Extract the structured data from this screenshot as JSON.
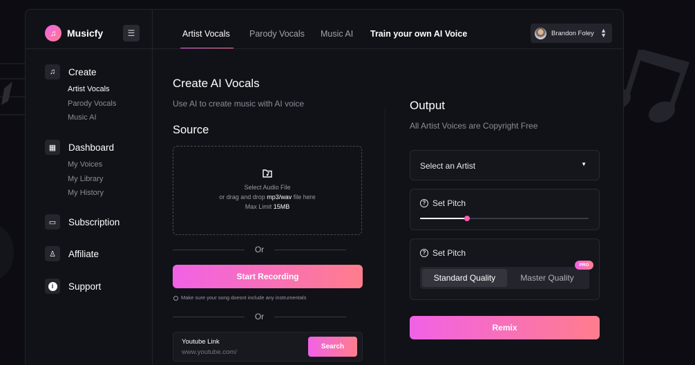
{
  "app": {
    "name": "Musicfy",
    "logo_icon": "music-note-icon"
  },
  "sidebar": {
    "groups": [
      {
        "label": "Create",
        "icon": "music-note-icon",
        "items": [
          "Artist Vocals",
          "Parody Vocals",
          "Music AI"
        ],
        "active_item": "Artist Vocals"
      },
      {
        "label": "Dashboard",
        "icon": "grid-icon",
        "items": [
          "My Voices",
          "My Library",
          "My History"
        ]
      },
      {
        "label": "Subscription",
        "icon": "ticket-icon",
        "items": []
      },
      {
        "label": "Affiliate",
        "icon": "users-icon",
        "items": []
      },
      {
        "label": "Support",
        "icon": "info-icon",
        "items": []
      }
    ]
  },
  "tabs": [
    "Artist Vocals",
    "Parody Vocals",
    "Music AI",
    "Train your own AI Voice"
  ],
  "active_tab": "Artist Vocals",
  "user": {
    "name": "Brandon Foley"
  },
  "create": {
    "title": "Create AI Vocals",
    "subtitle": "Use AI to create music with AI voice",
    "source_heading": "Source",
    "dropzone": {
      "line1": "Select Audio File",
      "line2_prefix": "or drag and drop ",
      "line2_formats": "mp3/wav",
      "line2_suffix": " file here",
      "line3_prefix": "Max Limit ",
      "line3_limit": "15MB"
    },
    "or_label": "Or",
    "record_label": "Start Recording",
    "record_note": "Make sure your song doesnt include any instrumentals",
    "youtube": {
      "label": "Youtube Link",
      "placeholder": "www.youtube.com/",
      "search_label": "Search"
    }
  },
  "output": {
    "title": "Output",
    "subtitle": "All Artist Voices are Copyright Free",
    "artist_select": "Select an Artist",
    "pitch_label": "Set Pitch",
    "pitch_value": 0.28,
    "quality_label": "Set Pitch",
    "quality_options": [
      "Standard Quality",
      "Master Quality"
    ],
    "quality_selected": "Standard Quality",
    "pro_badge": "PRO",
    "remix_label": "Remix"
  },
  "colors": {
    "accent_start": "#f062e6",
    "accent_end": "#ff7d8c",
    "background": "#0c0c12",
    "panel": "#111118"
  }
}
